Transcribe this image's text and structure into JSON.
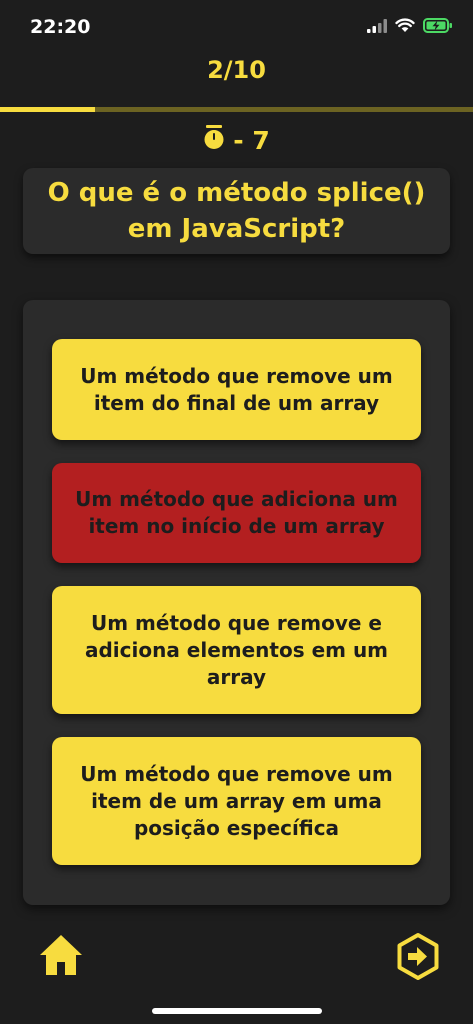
{
  "status": {
    "time": "22:20",
    "icons": [
      "signal-icon",
      "wifi-icon",
      "battery-charging-icon"
    ]
  },
  "progress": {
    "label": "2/10",
    "fraction": 0.2
  },
  "timer": {
    "icon": "stopwatch-icon",
    "label": "- 7"
  },
  "question": {
    "text": "O que é o método splice() em JavaScript?"
  },
  "answers": [
    {
      "text": "Um método que remove um item do final de um array",
      "state": "default"
    },
    {
      "text": "Um método que adiciona um item no início de um array",
      "state": "wrong"
    },
    {
      "text": "Um método que remove e adiciona elementos em um array",
      "state": "default"
    },
    {
      "text": "Um método que remove um item de um array em uma posição específica",
      "state": "default"
    }
  ],
  "nav": {
    "home_icon": "home-icon",
    "next_icon": "next-arrow-icon"
  },
  "colors": {
    "background": "#1d1d1d",
    "card": "#2b2b2b",
    "accent": "#f7dc3f",
    "wrong": "#b31f20",
    "battery_green": "#4cd964"
  }
}
